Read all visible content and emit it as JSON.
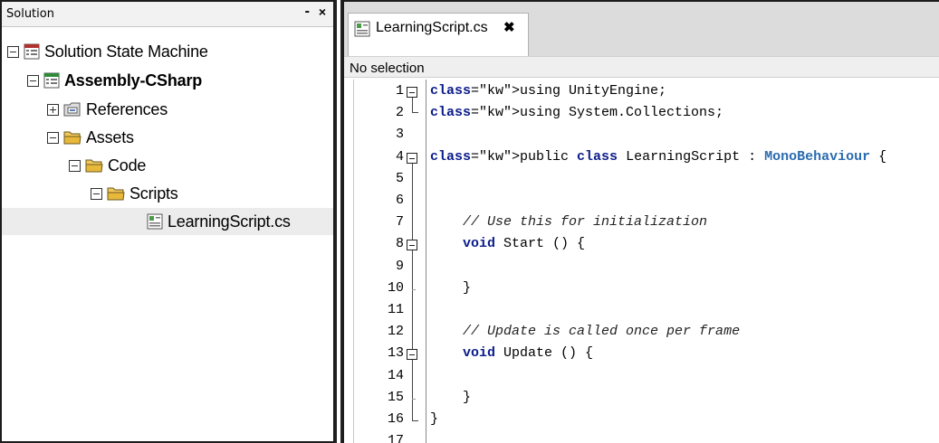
{
  "solution_panel": {
    "title": "Solution",
    "minimize_label": "-",
    "close_label": "×",
    "tree": [
      {
        "label": "Solution State Machine",
        "icon": "solution-icon",
        "bold": false,
        "expanded": true
      },
      {
        "label": "Assembly-CSharp",
        "icon": "project-icon",
        "bold": true,
        "expanded": true
      },
      {
        "label": "References",
        "icon": "references-folder-icon",
        "bold": false,
        "expanded": false
      },
      {
        "label": "Assets",
        "icon": "folder-icon",
        "bold": false,
        "expanded": true
      },
      {
        "label": "Code",
        "icon": "folder-icon",
        "bold": false,
        "expanded": true
      },
      {
        "label": "Scripts",
        "icon": "folder-icon",
        "bold": false,
        "expanded": true
      },
      {
        "label": "LearningScript.cs",
        "icon": "csharp-file-icon",
        "bold": false,
        "selected": true
      }
    ]
  },
  "editor": {
    "tab": {
      "label": "LearningScript.cs",
      "close_label": "✖",
      "icon": "csharp-file-icon"
    },
    "selection_text": "No selection",
    "lines": [
      {
        "n": "1",
        "code": "using UnityEngine;"
      },
      {
        "n": "2",
        "code": "using System.Collections;"
      },
      {
        "n": "3",
        "code": ""
      },
      {
        "n": "4",
        "code": "public class LearningScript : MonoBehaviour {"
      },
      {
        "n": "5",
        "code": ""
      },
      {
        "n": "6",
        "code": ""
      },
      {
        "n": "7",
        "code": "    // Use this for initialization"
      },
      {
        "n": "8",
        "code": "    void Start () {"
      },
      {
        "n": "9",
        "code": ""
      },
      {
        "n": "10",
        "code": "    }"
      },
      {
        "n": "11",
        "code": ""
      },
      {
        "n": "12",
        "code": "    // Update is called once per frame"
      },
      {
        "n": "13",
        "code": "    void Update () {"
      },
      {
        "n": "14",
        "code": ""
      },
      {
        "n": "15",
        "code": "    }"
      },
      {
        "n": "16",
        "code": "}"
      },
      {
        "n": "17",
        "code": ""
      }
    ]
  },
  "colors": {
    "keyword": "#0b1c8a",
    "type": "#2b6cb0",
    "folder": "#e8b83a",
    "selection_bg": "#ececec"
  }
}
